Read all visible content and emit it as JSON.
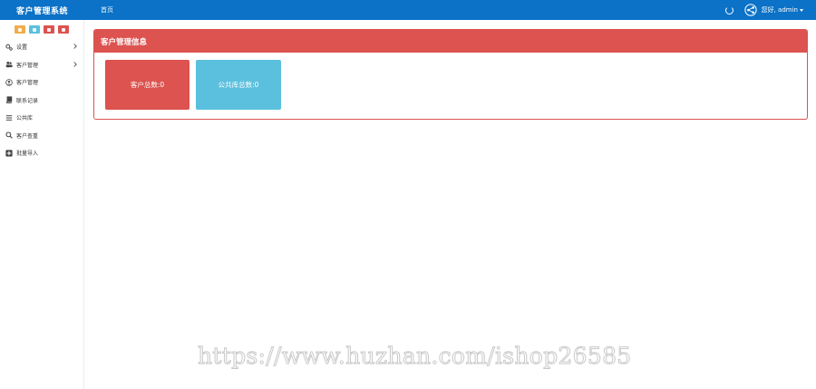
{
  "app": {
    "title": "客户管理系统",
    "nav_home": "首页",
    "user_label": "您好, admin",
    "accent_color": "#0b72c7"
  },
  "sidebar": {
    "shortcuts": [
      {
        "icon": "pin-icon",
        "color": "#f0ad4e"
      },
      {
        "icon": "file-icon",
        "color": "#5bc0de"
      },
      {
        "icon": "trash-icon",
        "color": "#dc534f"
      },
      {
        "icon": "power-icon",
        "color": "#dc534f"
      }
    ],
    "items": [
      {
        "label": "设置",
        "icon": "cogs-icon",
        "has_children": true
      },
      {
        "label": "客户管理",
        "icon": "users-icon",
        "has_children": true
      },
      {
        "label": "客户管理",
        "icon": "user-circle-icon",
        "has_children": false
      },
      {
        "label": "联系记录",
        "icon": "book-icon",
        "has_children": false
      },
      {
        "label": "公共库",
        "icon": "list-icon",
        "has_children": false
      },
      {
        "label": "客户查重",
        "icon": "search-icon",
        "has_children": false
      },
      {
        "label": "批量导入",
        "icon": "plus-square-icon",
        "has_children": false
      }
    ]
  },
  "main": {
    "panel_title": "客户管理信息",
    "stats": [
      {
        "label": "客户总数:0",
        "color": "#dc534f"
      },
      {
        "label": "公共库总数:0",
        "color": "#5bc0de"
      }
    ]
  },
  "watermark": "https://www.huzhan.com/ishop26585"
}
